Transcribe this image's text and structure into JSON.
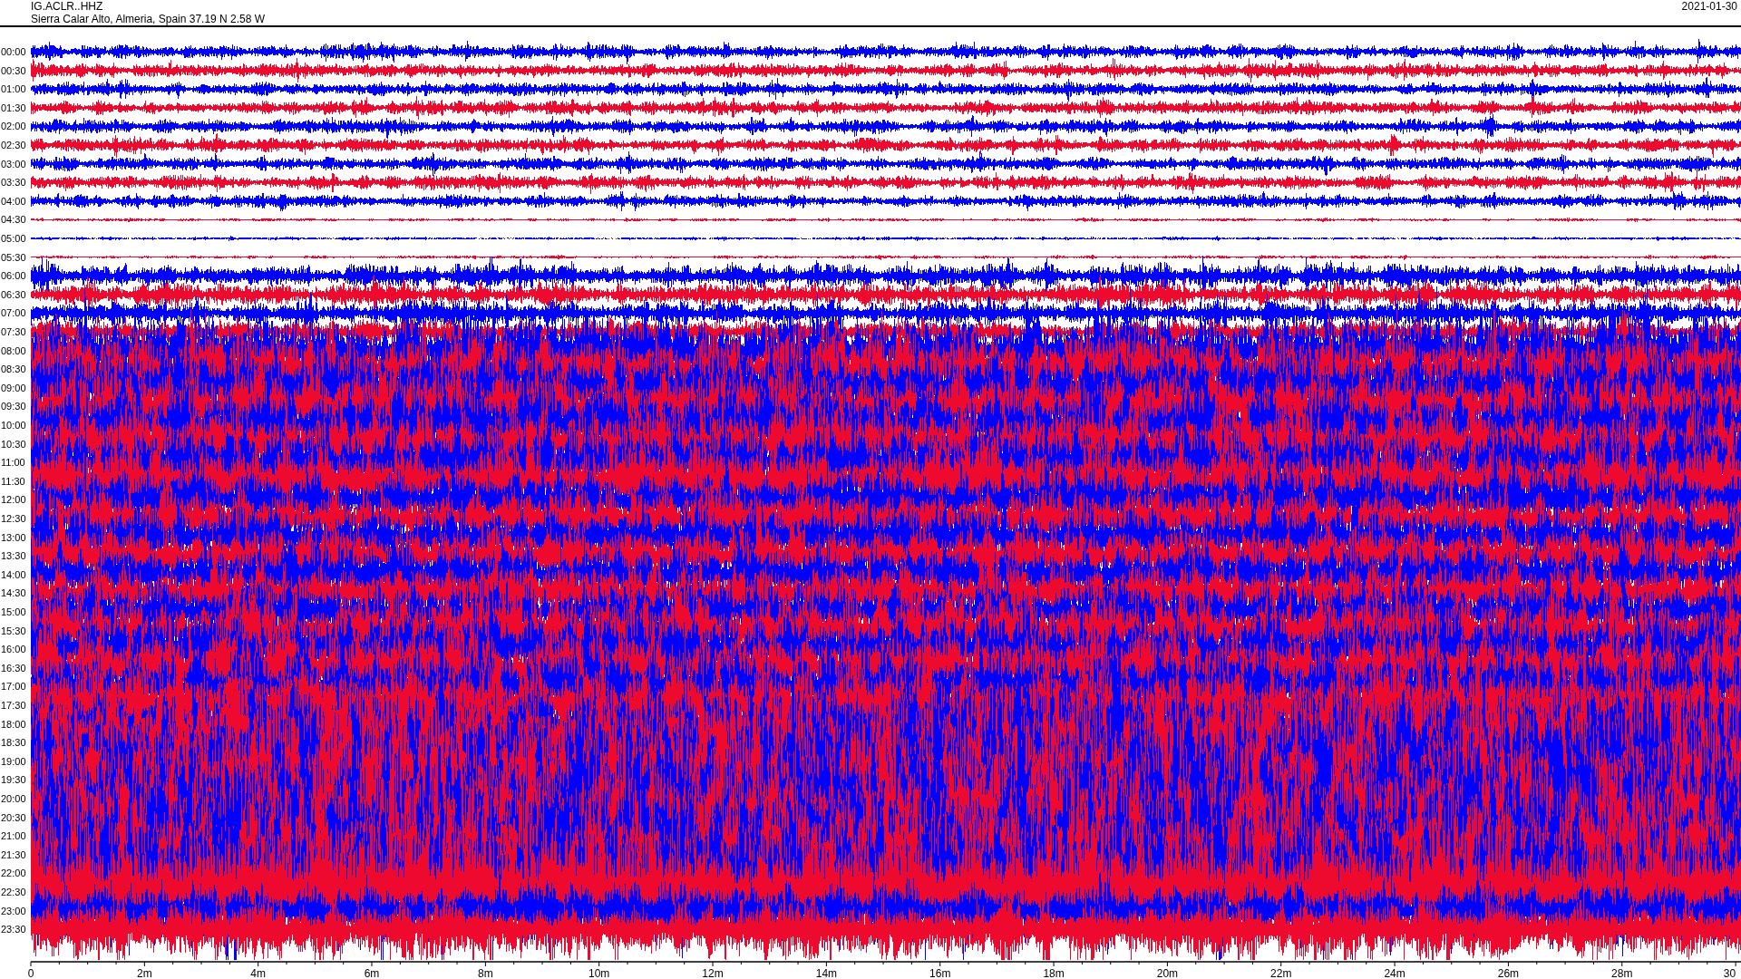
{
  "header": {
    "station": "IG.ACLR..HHZ",
    "location": "Sierra Calar Alto, Almeria, Spain  37.19 N 2.58 W",
    "date": "2021-01-30"
  },
  "rows": [
    "00:00",
    "00:30",
    "01:00",
    "01:30",
    "02:00",
    "02:30",
    "03:00",
    "03:30",
    "04:00",
    "04:30",
    "05:00",
    "05:30",
    "06:00",
    "06:30",
    "07:00",
    "07:30",
    "08:00",
    "08:30",
    "09:00",
    "09:30",
    "10:00",
    "10:30",
    "11:00",
    "11:30",
    "12:00",
    "12:30",
    "13:00",
    "13:30",
    "14:00",
    "14:30",
    "15:00",
    "15:30",
    "16:00",
    "16:30",
    "17:00",
    "17:30",
    "18:00",
    "18:30",
    "19:00",
    "19:30",
    "20:00",
    "20:30",
    "21:00",
    "21:30",
    "22:00",
    "22:30",
    "23:00",
    "23:30"
  ],
  "x_axis": {
    "ticks": [
      "0",
      "2m",
      "4m",
      "6m",
      "8m",
      "10m",
      "12m",
      "14m",
      "16m",
      "18m",
      "20m",
      "22m",
      "24m",
      "26m",
      "28m",
      "30"
    ]
  }
}
